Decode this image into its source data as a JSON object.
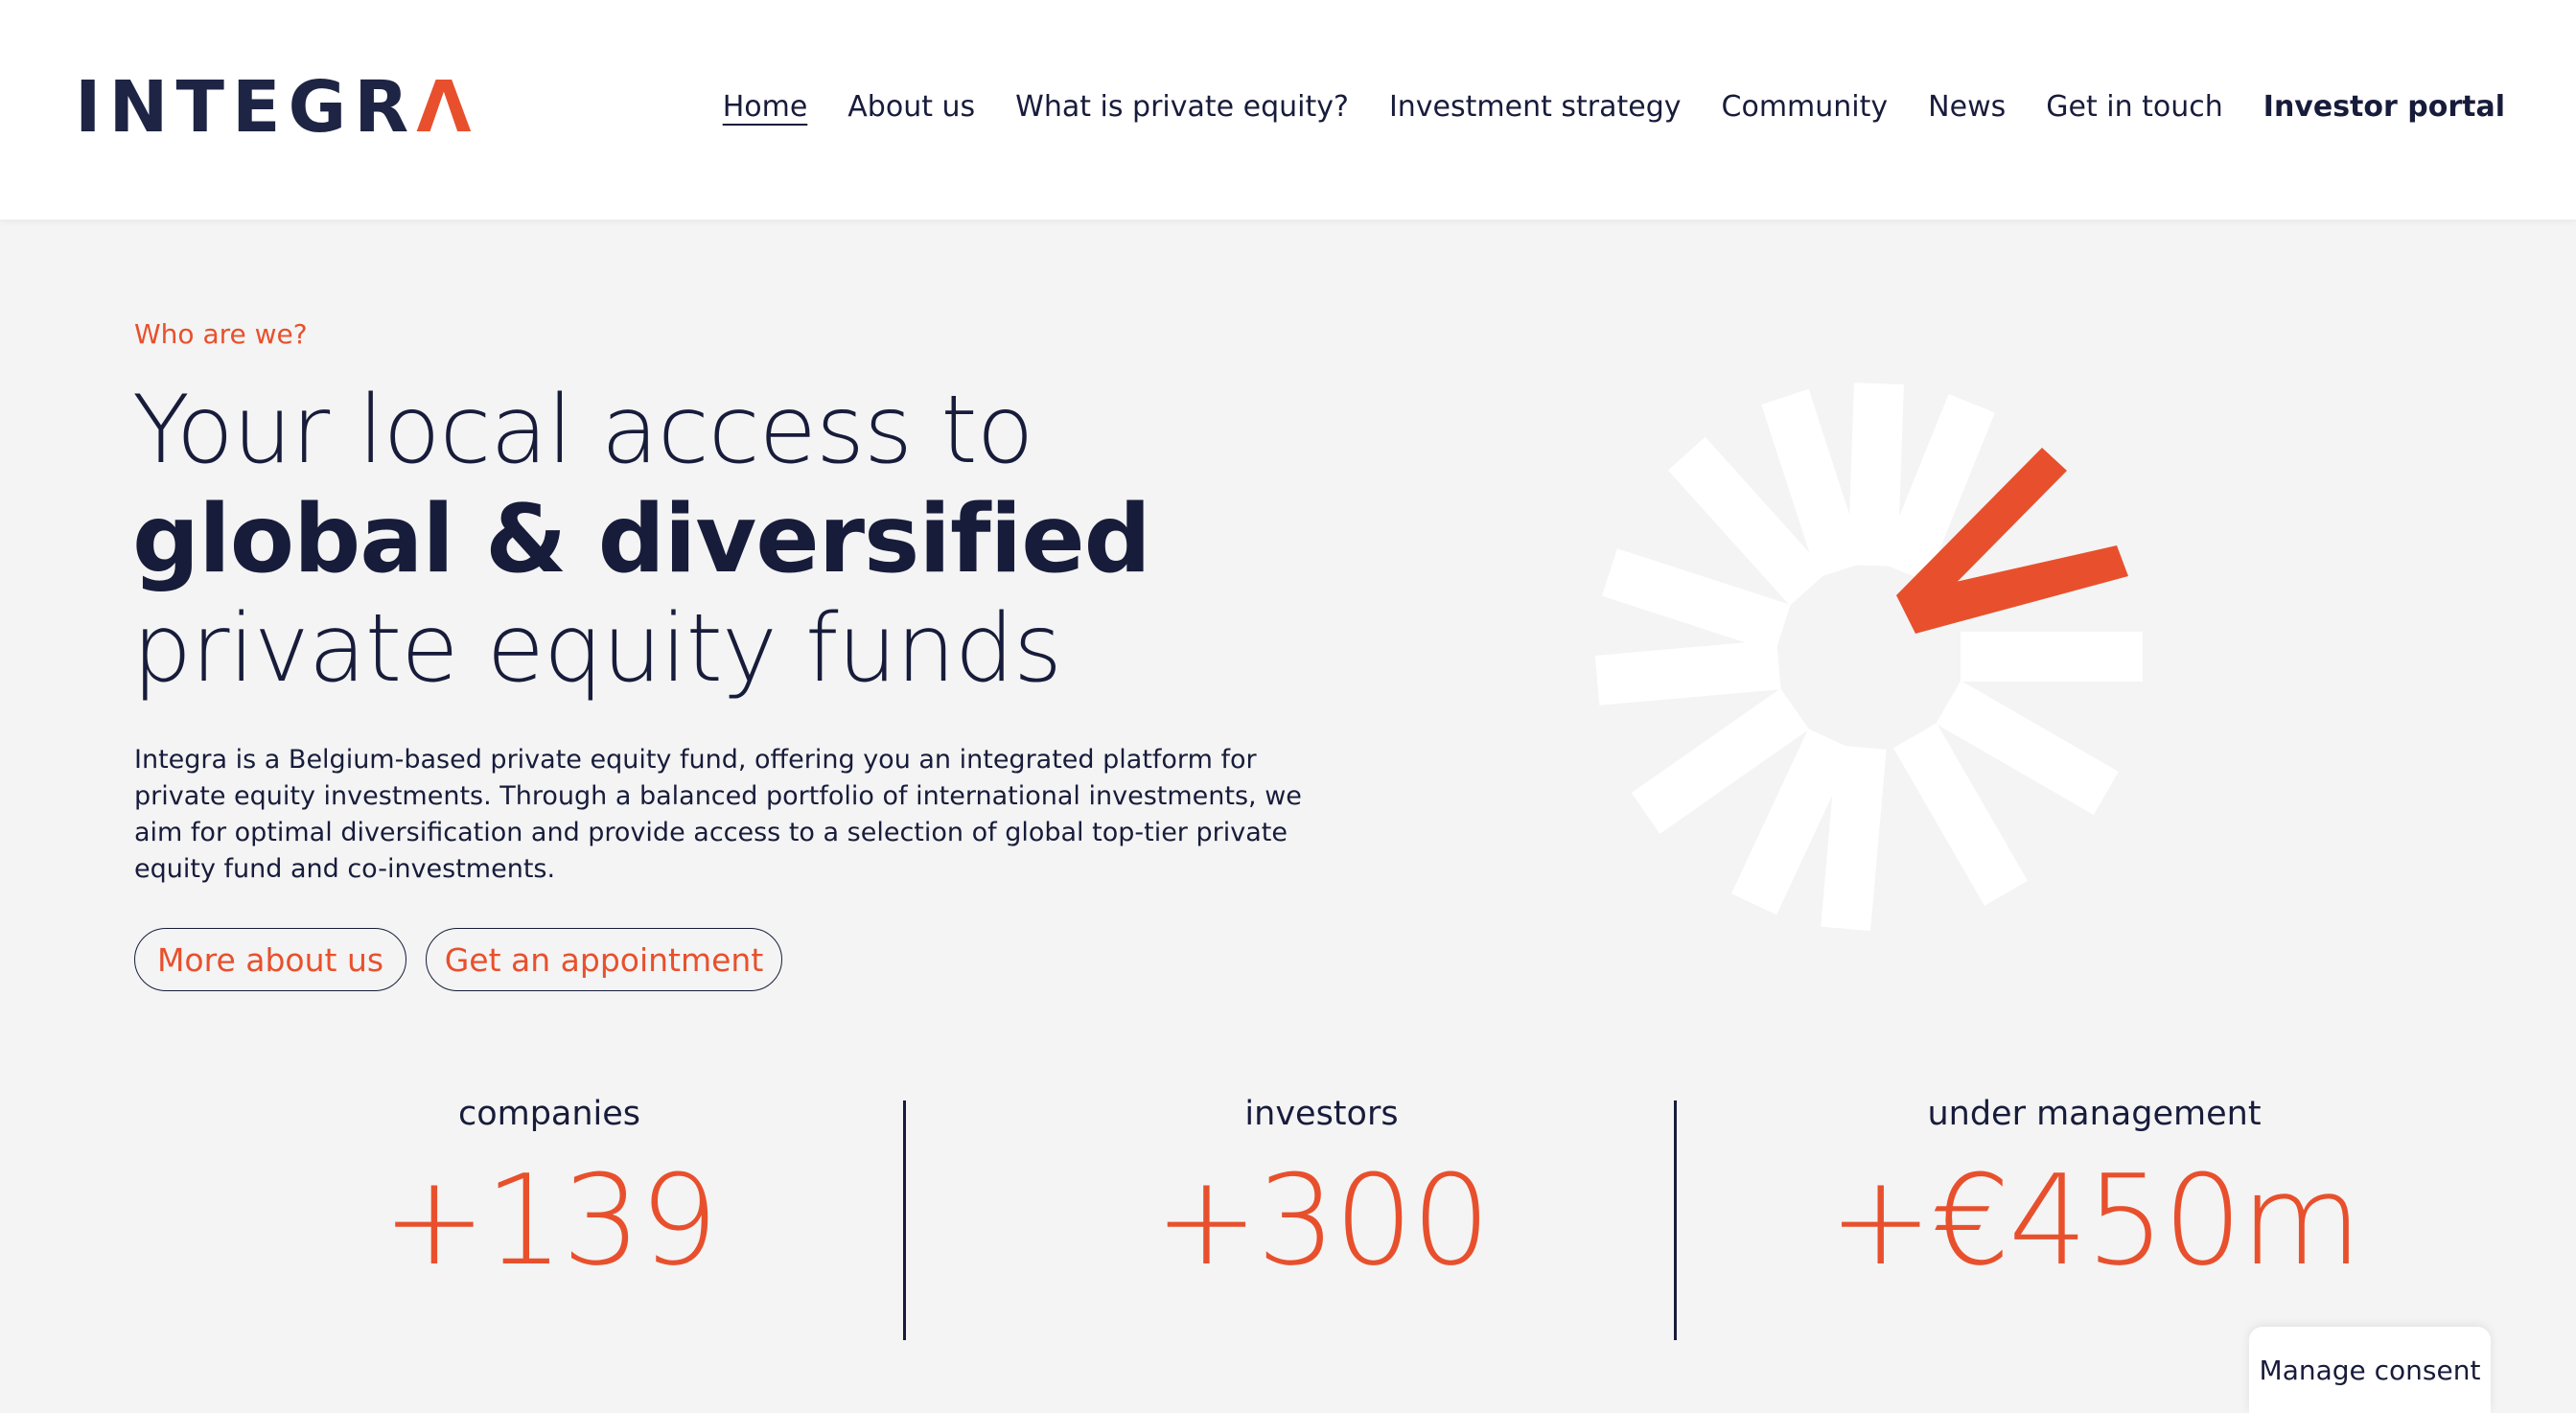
{
  "logo": {
    "text_main": "INTEGR",
    "text_accent": "Λ"
  },
  "nav": {
    "items": [
      {
        "label": "Home"
      },
      {
        "label": "About us"
      },
      {
        "label": "What is private equity?"
      },
      {
        "label": "Investment strategy"
      },
      {
        "label": "Community"
      },
      {
        "label": "News"
      },
      {
        "label": "Get in touch"
      },
      {
        "label": "Investor portal"
      }
    ]
  },
  "hero": {
    "eyebrow": "Who are we?",
    "headline_part1": "Your local access to ",
    "headline_bold": "global & diversified",
    "headline_part2": " private equity funds",
    "intro": "Integra is a Belgium-based private equity fund, offering you an integrated platform for private equity investments. Through a balanced portfolio of international investments, we aim for optimal diversification and provide access to a selection of global top-tier private equity fund and co-investments.",
    "btn_more": "More about us",
    "btn_appointment": "Get an appointment"
  },
  "stats": [
    {
      "label": "companies",
      "value": "+139"
    },
    {
      "label": "investors",
      "value": "+300"
    },
    {
      "label": "under management",
      "value": "+€450m"
    }
  ],
  "consent": {
    "label": "Manage consent"
  },
  "colors": {
    "accent": "#e8502d",
    "navy": "#181c3b",
    "background": "#f3f4f3"
  },
  "icons": {
    "hero_graphic": "integra-radial-mark-icon"
  }
}
